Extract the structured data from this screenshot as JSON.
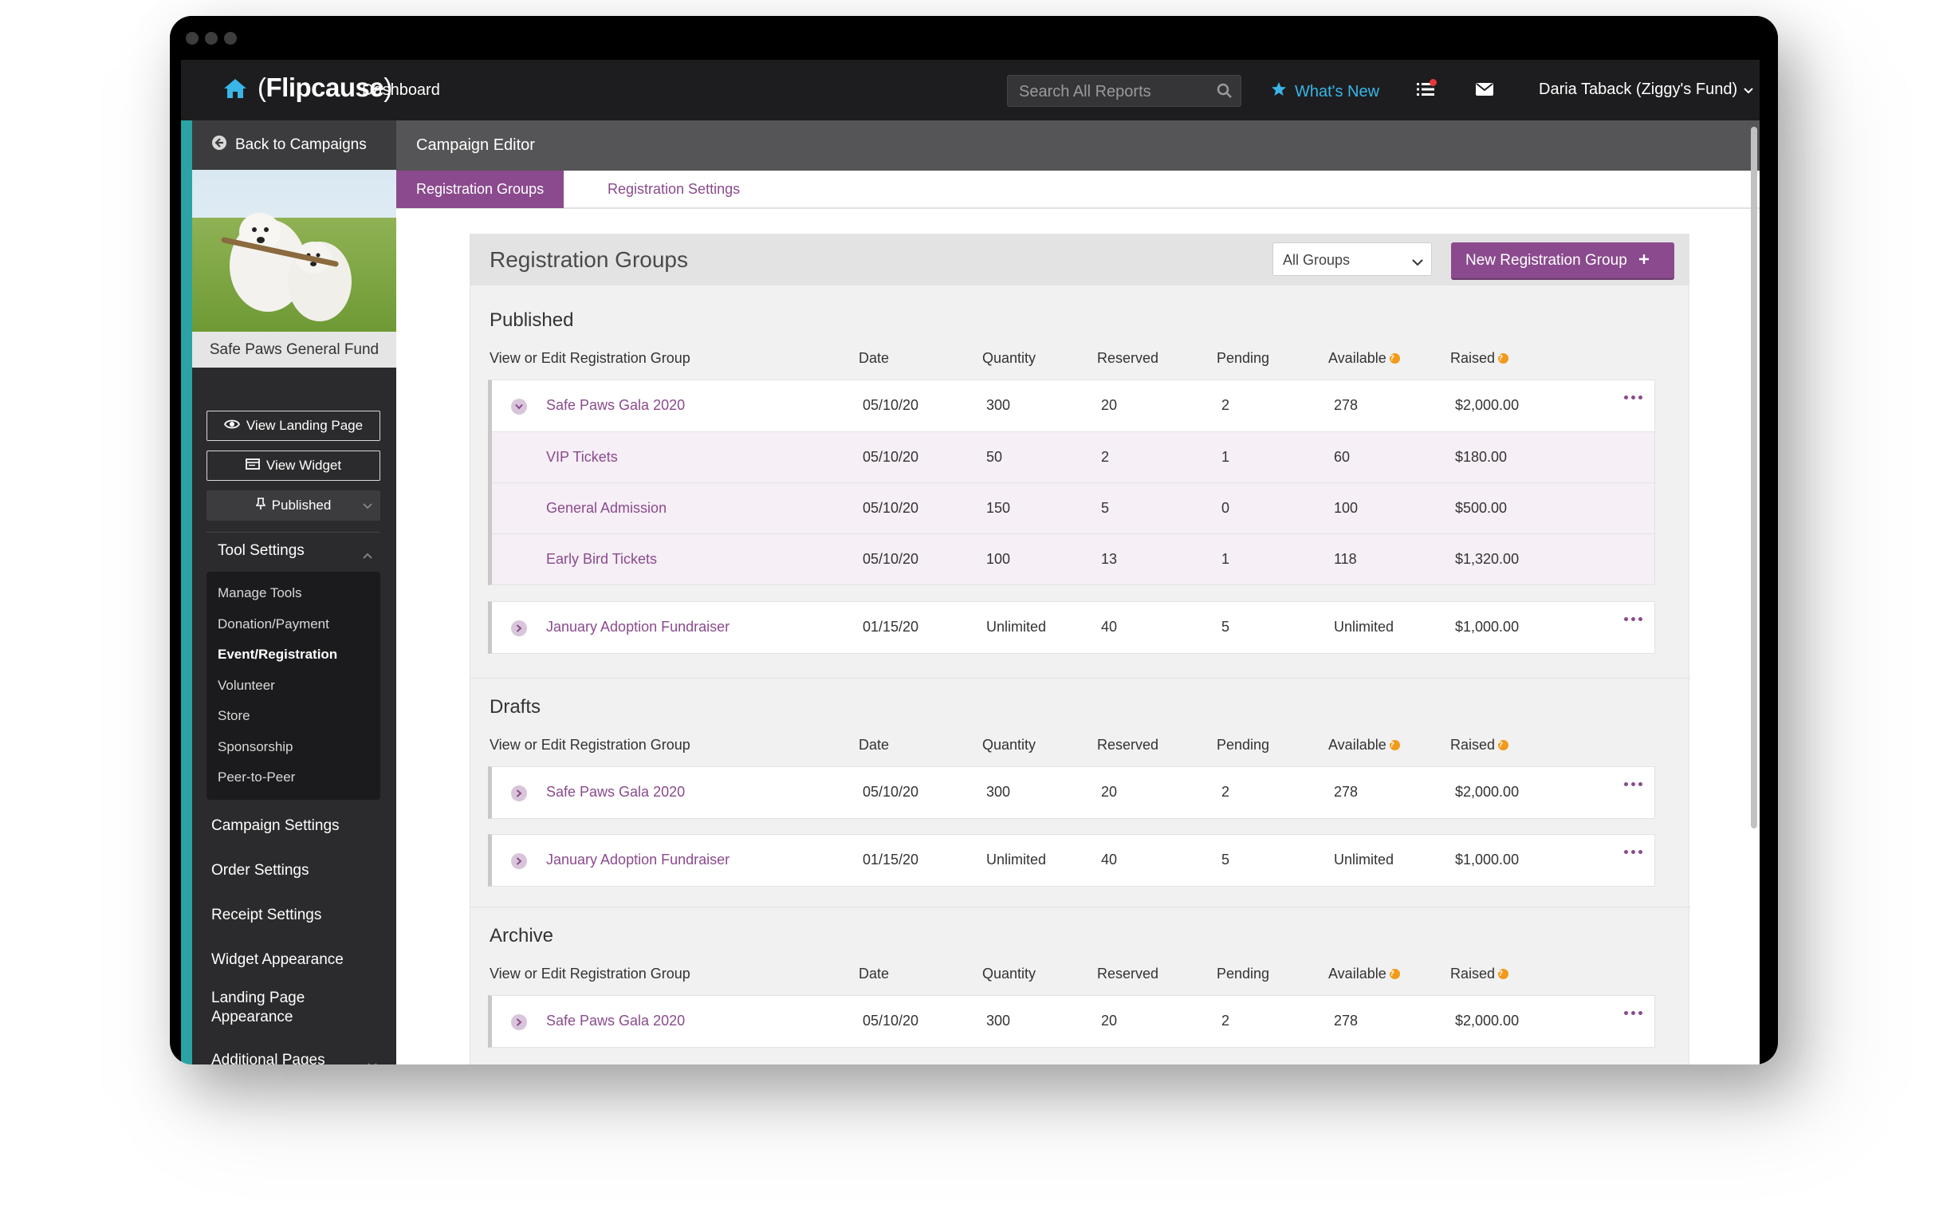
{
  "nav": {
    "logo": "Flipcause",
    "dashboard_label": "Dashboard",
    "search_placeholder": "Search All Reports",
    "whats_new": "What's New",
    "user": "Daria Taback (Ziggy's Fund)"
  },
  "sidebar": {
    "back": "Back to Campaigns",
    "campaign_name": "Safe Paws General Fund",
    "view_landing": "View Landing Page",
    "view_widget": "View Widget",
    "status": "Published",
    "tool_settings": "Tool Settings",
    "tools": [
      "Manage Tools",
      "Donation/Payment",
      "Event/Registration",
      "Volunteer",
      "Store",
      "Sponsorship",
      "Peer-to-Peer"
    ],
    "active_tool": "Event/Registration",
    "links": [
      "Campaign Settings",
      "Order Settings",
      "Receipt Settings",
      "Widget Appearance",
      "Landing Page Appearance",
      "Additional Pages"
    ]
  },
  "editor": {
    "title": "Campaign Editor",
    "tabs": [
      "Registration Groups",
      "Registration Settings"
    ]
  },
  "panel": {
    "title": "Registration Groups",
    "filter": "All Groups",
    "new_button": "New Registration Group",
    "columns": [
      "View or Edit Registration Group",
      "Date",
      "Quantity",
      "Reserved",
      "Pending",
      "Available",
      "Raised"
    ],
    "sections": [
      {
        "title": "Published",
        "groups": [
          {
            "name": "Safe Paws Gala 2020",
            "date": "05/10/20",
            "quantity": "300",
            "reserved": "20",
            "pending": "2",
            "available": "278",
            "raised": "$2,000.00",
            "children": [
              {
                "name": "VIP Tickets",
                "date": "05/10/20",
                "quantity": "50",
                "reserved": "2",
                "pending": "1",
                "available": "60",
                "raised": "$180.00"
              },
              {
                "name": "General Admission",
                "date": "05/10/20",
                "quantity": "150",
                "reserved": "5",
                "pending": "0",
                "available": "100",
                "raised": "$500.00"
              },
              {
                "name": "Early Bird Tickets",
                "date": "05/10/20",
                "quantity": "100",
                "reserved": "13",
                "pending": "1",
                "available": "118",
                "raised": "$1,320.00"
              }
            ]
          },
          {
            "name": "January Adoption Fundraiser",
            "date": "01/15/20",
            "quantity": "Unlimited",
            "reserved": "40",
            "pending": "5",
            "available": "Unlimited",
            "raised": "$1,000.00"
          }
        ]
      },
      {
        "title": "Drafts",
        "groups": [
          {
            "name": "Safe Paws Gala 2020",
            "date": "05/10/20",
            "quantity": "300",
            "reserved": "20",
            "pending": "2",
            "available": "278",
            "raised": "$2,000.00"
          },
          {
            "name": "January Adoption Fundraiser",
            "date": "01/15/20",
            "quantity": "Unlimited",
            "reserved": "40",
            "pending": "5",
            "available": "Unlimited",
            "raised": "$1,000.00"
          }
        ]
      },
      {
        "title": "Archive",
        "groups": [
          {
            "name": "Safe Paws Gala 2020",
            "date": "05/10/20",
            "quantity": "300",
            "reserved": "20",
            "pending": "2",
            "available": "278",
            "raised": "$2,000.00"
          }
        ]
      }
    ]
  },
  "colors": {
    "brand_purple": "#8a4a8d",
    "teal": "#29a3a3",
    "nav_dark": "#1d1d1f",
    "whats_new_blue": "#39b5e6",
    "info_orange": "#f29a1a"
  }
}
